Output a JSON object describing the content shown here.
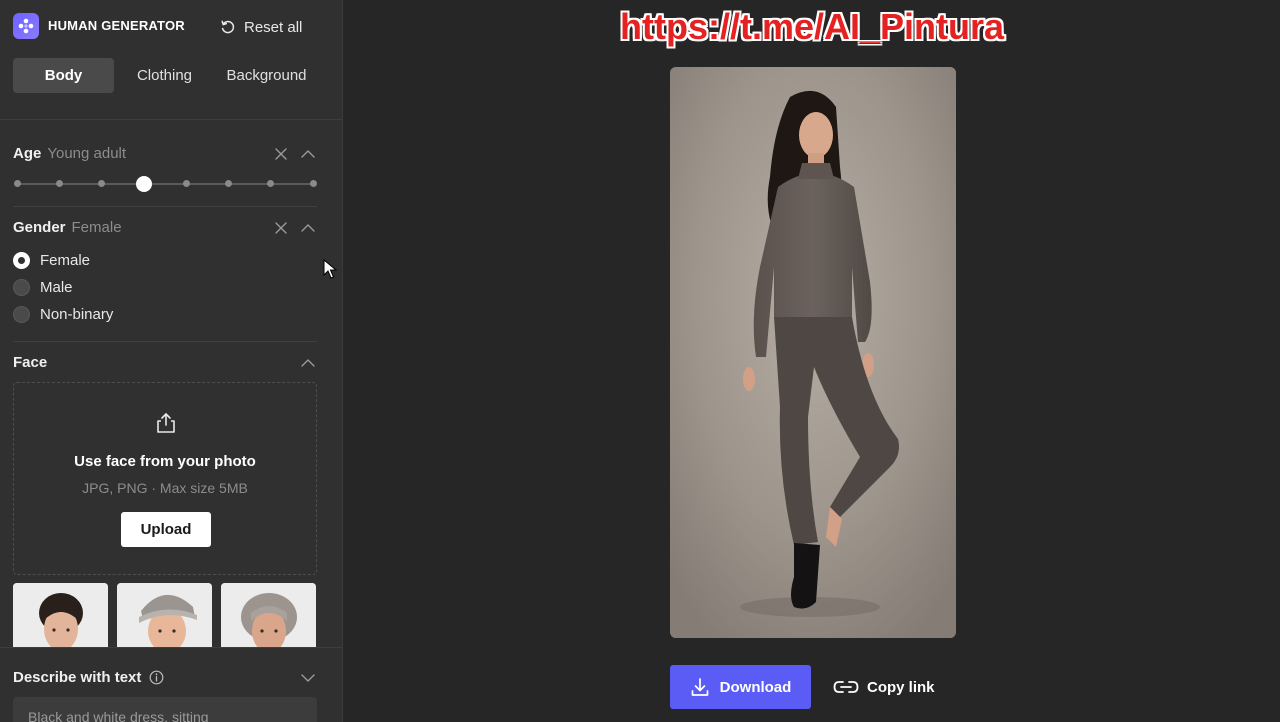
{
  "brand": {
    "name": "HUMAN GENERATOR",
    "icon": "flower-logo-icon",
    "accent": "#6c63ff"
  },
  "toolbar": {
    "reset_label": "Reset all",
    "reset_icon": "reset-icon"
  },
  "tabs": [
    {
      "label": "Body",
      "active": true
    },
    {
      "label": "Clothing",
      "active": false
    },
    {
      "label": "Background",
      "active": false
    }
  ],
  "age": {
    "title": "Age",
    "value": "Young adult",
    "steps": 8,
    "selected_index": 3
  },
  "gender": {
    "title": "Gender",
    "value": "Female",
    "options": [
      {
        "label": "Female",
        "checked": true
      },
      {
        "label": "Male",
        "checked": false
      },
      {
        "label": "Non-binary",
        "checked": false
      }
    ]
  },
  "face": {
    "title": "Face",
    "upload_title": "Use face from your photo",
    "upload_hint": "JPG, PNG · Max size 5MB",
    "upload_button": "Upload",
    "samples": [
      "face-sample-woman",
      "face-sample-man-cap",
      "face-sample-elderly-woman"
    ]
  },
  "describe": {
    "title": "Describe with text",
    "info_icon": "info-icon",
    "value": "Black and white dress, sitting"
  },
  "main": {
    "watermark": "https://t.me/AI_Pintura",
    "download_label": "Download",
    "copy_link_label": "Copy link",
    "download_color": "#5b5cf6"
  }
}
